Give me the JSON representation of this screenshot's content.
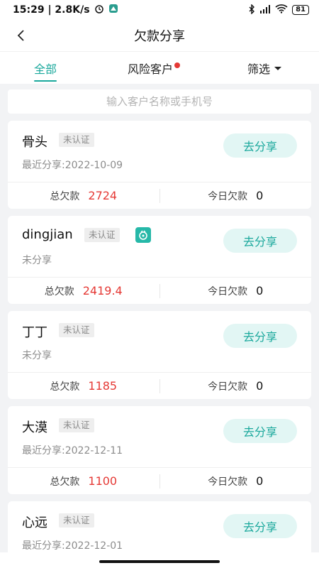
{
  "status_bar": {
    "time_speed": "15:29 | 2.8K/s",
    "battery": "81"
  },
  "header": {
    "title": "欠款分享"
  },
  "tabs": [
    {
      "label": "全部",
      "active": true
    },
    {
      "label": "风险客户",
      "has_dot": true
    },
    {
      "label": "筛选",
      "dropdown": true
    }
  ],
  "search": {
    "placeholder": "输入客户名称或手机号",
    "value": ""
  },
  "labels": {
    "total_debt": "总欠款",
    "today_debt": "今日欠款",
    "share_button": "去分享"
  },
  "customers": [
    {
      "name": "骨头",
      "badge": "未认证",
      "last_share": "最近分享:2022-10-09",
      "total_debt": "2724",
      "today_debt": "0",
      "wechat": false
    },
    {
      "name": "dingjian",
      "badge": "未认证",
      "last_share": "未分享",
      "total_debt": "2419.4",
      "today_debt": "0",
      "wechat": true
    },
    {
      "name": "丁丁",
      "badge": "未认证",
      "last_share": "未分享",
      "total_debt": "1185",
      "today_debt": "0",
      "wechat": false
    },
    {
      "name": "大漠",
      "badge": "未认证",
      "last_share": "最近分享:2022-12-11",
      "total_debt": "1100",
      "today_debt": "0",
      "wechat": false
    },
    {
      "name": "心远",
      "badge": "未认证",
      "last_share": "最近分享:2022-12-01",
      "total_debt": "",
      "today_debt": "",
      "wechat": false
    }
  ],
  "colors": {
    "accent": "#1aa89c",
    "debt_red": "#e53935",
    "background": "#f2f3f5"
  }
}
